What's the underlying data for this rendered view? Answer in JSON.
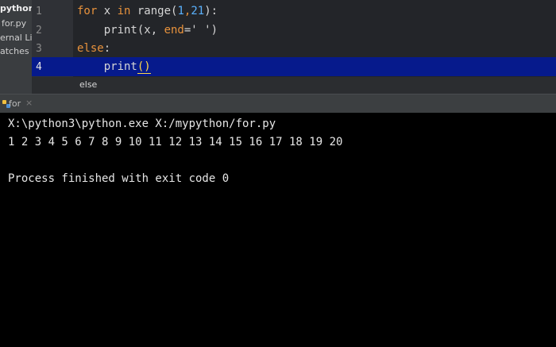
{
  "sidebar": {
    "items": [
      {
        "label": "python"
      },
      {
        "label": "for.py"
      },
      {
        "label": "ernal Lib"
      },
      {
        "label": "atches a"
      }
    ]
  },
  "editor": {
    "line_numbers": [
      "1",
      "2",
      "3",
      "4"
    ],
    "current_line": 4,
    "code": {
      "l1": {
        "kw_for": "for",
        "var": " x ",
        "kw_in": "in",
        "fn": " range(",
        "n1": "1",
        "comma": ",",
        "n2": "21",
        "end": "):"
      },
      "l2": {
        "indent": "    ",
        "fn": "print(x, ",
        "kw_end": "end",
        "rest": "=' ')"
      },
      "l3": {
        "kw_else": "else",
        "colon": ":"
      },
      "l4": {
        "indent": "    ",
        "fn": "print",
        "bracket": "()"
      }
    }
  },
  "breadcrumb": {
    "label": "else"
  },
  "run_tab": {
    "label": "for",
    "close": "×",
    "icon": "python-run-icon"
  },
  "console": {
    "lines": [
      "X:\\python3\\python.exe X:/mypython/for.py",
      "1 2 3 4 5 6 7 8 9 10 11 12 13 14 15 16 17 18 19 20",
      "",
      "Process finished with exit code 0"
    ]
  },
  "colors": {
    "keyword": "#e8923c",
    "number": "#5ab2ff",
    "current_line_bg": "#061a8c",
    "console_bg": "#000000"
  }
}
